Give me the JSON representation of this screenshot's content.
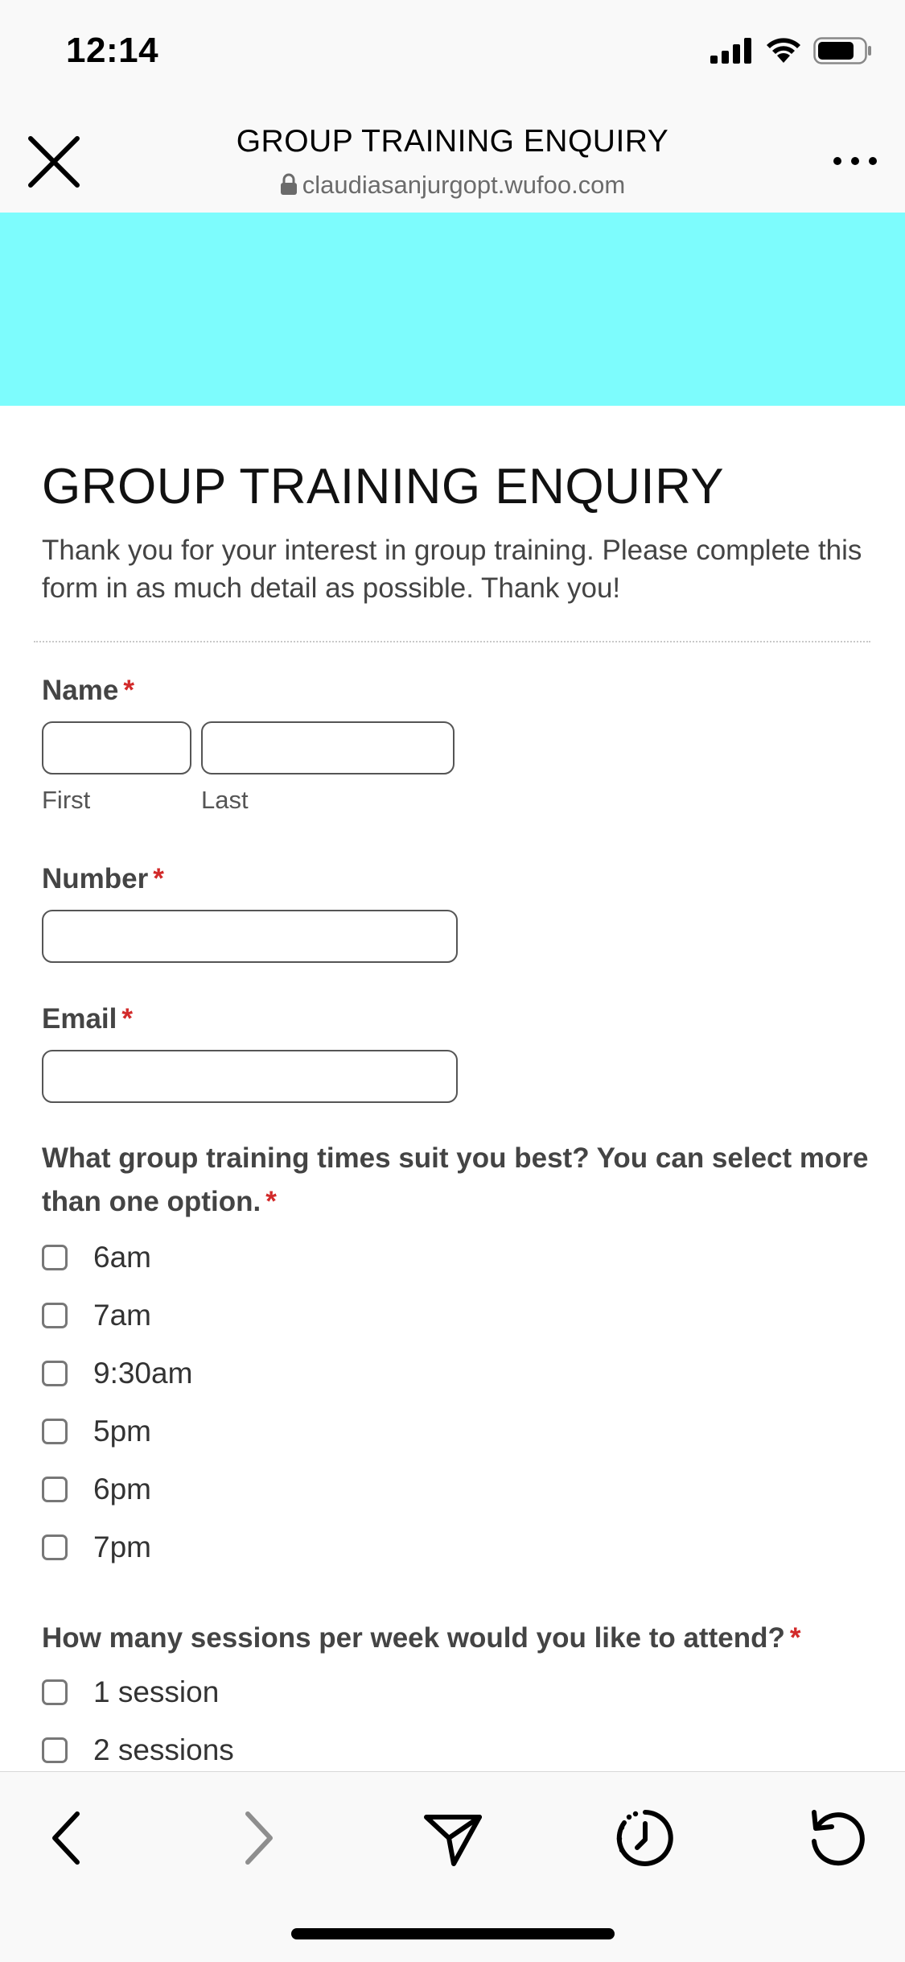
{
  "status_bar": {
    "time": "12:14"
  },
  "browser": {
    "title": "GROUP TRAINING ENQUIRY",
    "url": "claudiasanjurgopt.wufoo.com"
  },
  "banner": {
    "color": "#7dfcfd"
  },
  "form": {
    "title": "GROUP TRAINING ENQUIRY",
    "description": "Thank you for your interest in group training. Please complete this form in as much detail as possible. Thank you!",
    "required_mark": "*",
    "name": {
      "label": "Name",
      "first_sublabel": "First",
      "last_sublabel": "Last",
      "first_value": "",
      "last_value": ""
    },
    "number": {
      "label": "Number",
      "value": ""
    },
    "email": {
      "label": "Email",
      "value": ""
    },
    "times_question": "What group training times suit you best? You can select more than one option.",
    "times_options": [
      "6am",
      "7am",
      "9:30am",
      "5pm",
      "6pm",
      "7pm"
    ],
    "sessions_question": "How many sessions per week would you like to attend?",
    "sessions_options": [
      "1 session",
      "2 sessions"
    ]
  },
  "toolbar": {
    "icons": [
      "back-icon",
      "forward-icon",
      "share-icon",
      "history-icon",
      "reload-icon"
    ]
  },
  "colors": {
    "accent_required": "#d22a2a",
    "banner": "#7dfcfd",
    "forward_disabled": "#8e8e8e"
  }
}
